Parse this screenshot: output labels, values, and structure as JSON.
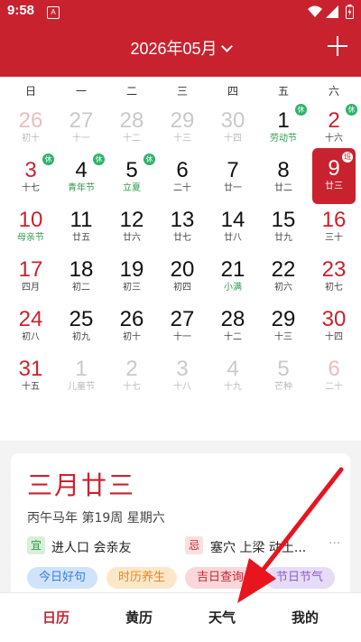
{
  "status": {
    "time": "9:58",
    "notification": "A"
  },
  "header": {
    "title": "2026年05月"
  },
  "weekdays": [
    "日",
    "一",
    "二",
    "三",
    "四",
    "五",
    "六"
  ],
  "days": [
    {
      "num": "26",
      "lunar": "初十",
      "faded": true,
      "red": true
    },
    {
      "num": "27",
      "lunar": "十一",
      "faded": true
    },
    {
      "num": "28",
      "lunar": "十二",
      "faded": true
    },
    {
      "num": "29",
      "lunar": "十三",
      "faded": true
    },
    {
      "num": "30",
      "lunar": "十四",
      "faded": true
    },
    {
      "num": "1",
      "lunar": "劳动节",
      "green": true,
      "badge": "休"
    },
    {
      "num": "2",
      "lunar": "十六",
      "red": true,
      "badge": "休"
    },
    {
      "num": "3",
      "lunar": "十七",
      "red": true,
      "badge": "休"
    },
    {
      "num": "4",
      "lunar": "青年节",
      "green": true,
      "badge": "休"
    },
    {
      "num": "5",
      "lunar": "立夏",
      "green": true,
      "badge": "休"
    },
    {
      "num": "6",
      "lunar": "二十"
    },
    {
      "num": "7",
      "lunar": "廿一"
    },
    {
      "num": "8",
      "lunar": "廿二"
    },
    {
      "num": "9",
      "lunar": "廿三",
      "selected": true,
      "badge": "班"
    },
    {
      "num": "10",
      "lunar": "母亲节",
      "red": true,
      "green": true
    },
    {
      "num": "11",
      "lunar": "廿五"
    },
    {
      "num": "12",
      "lunar": "廿六"
    },
    {
      "num": "13",
      "lunar": "廿七"
    },
    {
      "num": "14",
      "lunar": "廿八"
    },
    {
      "num": "15",
      "lunar": "廿九"
    },
    {
      "num": "16",
      "lunar": "三十",
      "red": true
    },
    {
      "num": "17",
      "lunar": "四月",
      "red": true
    },
    {
      "num": "18",
      "lunar": "初二"
    },
    {
      "num": "19",
      "lunar": "初三"
    },
    {
      "num": "20",
      "lunar": "初四"
    },
    {
      "num": "21",
      "lunar": "小满",
      "green": true
    },
    {
      "num": "22",
      "lunar": "初六"
    },
    {
      "num": "23",
      "lunar": "初七",
      "red": true
    },
    {
      "num": "24",
      "lunar": "初八",
      "red": true
    },
    {
      "num": "25",
      "lunar": "初九"
    },
    {
      "num": "26",
      "lunar": "初十"
    },
    {
      "num": "27",
      "lunar": "十一"
    },
    {
      "num": "28",
      "lunar": "十二"
    },
    {
      "num": "29",
      "lunar": "十三"
    },
    {
      "num": "30",
      "lunar": "十四",
      "red": true
    },
    {
      "num": "31",
      "lunar": "十五",
      "red": true
    },
    {
      "num": "1",
      "lunar": "儿童节",
      "faded": true
    },
    {
      "num": "2",
      "lunar": "十七",
      "faded": true
    },
    {
      "num": "3",
      "lunar": "十八",
      "faded": true
    },
    {
      "num": "4",
      "lunar": "十九",
      "faded": true
    },
    {
      "num": "5",
      "lunar": "芒种",
      "faded": true
    },
    {
      "num": "6",
      "lunar": "二十",
      "faded": true,
      "red": true
    }
  ],
  "detail": {
    "lunar_date": "三月廿三",
    "ganzhi": "丙午马年  第19周  星期六",
    "yi_label": "宜",
    "yi_text": "进人口  会亲友",
    "ji_label": "忌",
    "ji_text": "塞穴  上梁  动土...",
    "more": "···",
    "pills": [
      "今日好句",
      "时历养生",
      "吉日查询",
      "节日节气"
    ]
  },
  "tabs": [
    "日历",
    "黄历",
    "天气",
    "我的"
  ],
  "colors": {
    "brand": "#c9222f",
    "rest_badge": "#2eb26a",
    "holiday_text": "#2e9a4a"
  }
}
